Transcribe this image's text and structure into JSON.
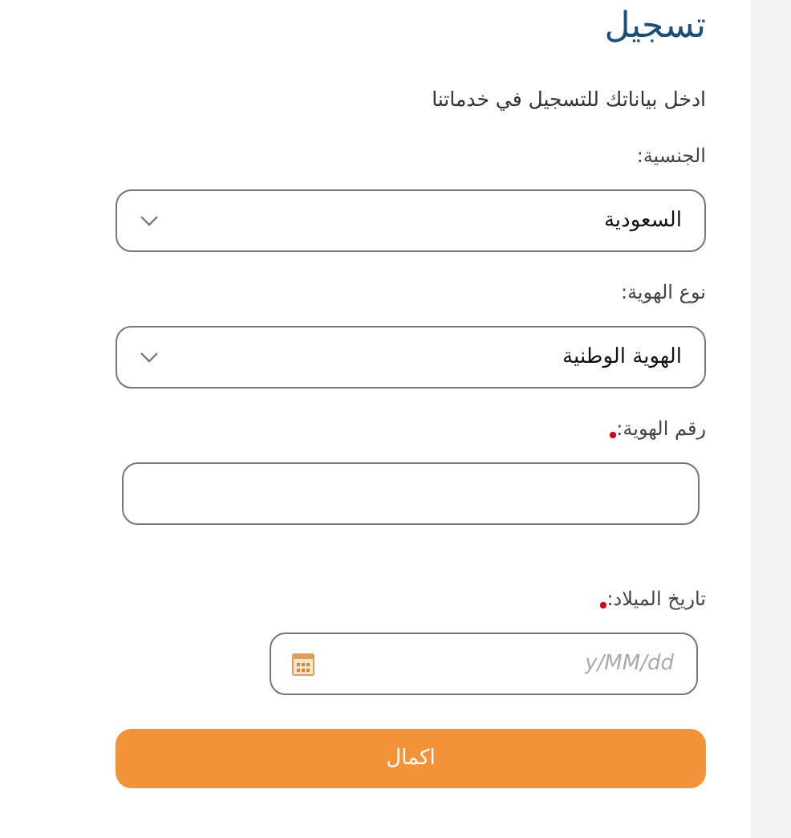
{
  "title": "تسجيل",
  "subtitle": "ادخل بياناتك للتسجيل في خدماتنا",
  "fields": [
    {
      "kind": "select",
      "label": "الجنسية:",
      "required": false,
      "value": "السعودية"
    },
    {
      "kind": "select",
      "label": "نوع الهوية:",
      "required": false,
      "value": "الهوية الوطنية"
    },
    {
      "kind": "text",
      "label": "رقم الهوية:",
      "required": true
    },
    {
      "kind": "date",
      "label": "تاريخ الميلاد:",
      "required": true,
      "placeholder": "y/MM/dd"
    }
  ],
  "submit": "اكمال"
}
